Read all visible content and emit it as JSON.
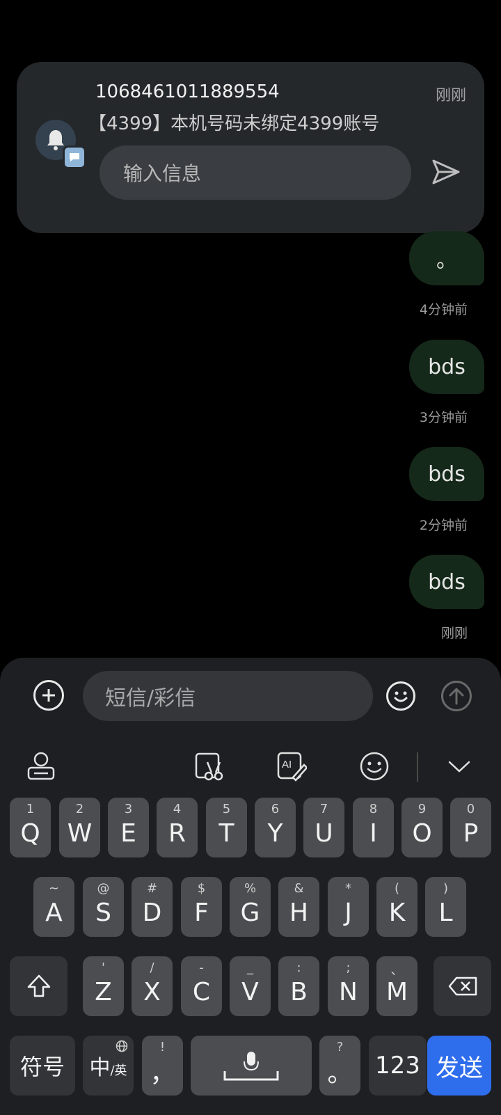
{
  "notification": {
    "sender": "1068461011889554",
    "time": "刚刚",
    "body": "【4399】本机号码未绑定4399账号",
    "reply_placeholder": "输入信息",
    "icon": "bell-icon",
    "badge_icon": "message-icon",
    "send_icon": "send-icon"
  },
  "messages": [
    {
      "text": "。",
      "time": "4分钟前"
    },
    {
      "text": "bds",
      "time": "3分钟前"
    },
    {
      "text": "bds",
      "time": "2分钟前"
    },
    {
      "text": "bds",
      "time": "刚刚"
    }
  ],
  "compose": {
    "placeholder": "短信/彩信",
    "add_icon": "plus-circle-icon",
    "emoji_icon": "emoji-icon",
    "send_icon": "arrow-up-icon"
  },
  "keyboard_toolbar": {
    "items": [
      "keyboard-settings-icon",
      "clipboard-edit-icon",
      "ai-write-icon",
      "emoji-icon",
      "chevron-down-icon"
    ]
  },
  "keyboard": {
    "row1": [
      {
        "main": "Q",
        "sub": "1"
      },
      {
        "main": "W",
        "sub": "2"
      },
      {
        "main": "E",
        "sub": "3"
      },
      {
        "main": "R",
        "sub": "4"
      },
      {
        "main": "T",
        "sub": "5"
      },
      {
        "main": "Y",
        "sub": "6"
      },
      {
        "main": "U",
        "sub": "7"
      },
      {
        "main": "I",
        "sub": "8"
      },
      {
        "main": "O",
        "sub": "9"
      },
      {
        "main": "P",
        "sub": "0"
      }
    ],
    "row2": [
      {
        "main": "A",
        "sub": "~"
      },
      {
        "main": "S",
        "sub": "@"
      },
      {
        "main": "D",
        "sub": "#"
      },
      {
        "main": "F",
        "sub": "$"
      },
      {
        "main": "G",
        "sub": "%"
      },
      {
        "main": "H",
        "sub": "&"
      },
      {
        "main": "J",
        "sub": "*"
      },
      {
        "main": "K",
        "sub": "("
      },
      {
        "main": "L",
        "sub": ")"
      }
    ],
    "row3": [
      {
        "main": "Z",
        "sub": "'"
      },
      {
        "main": "X",
        "sub": "/"
      },
      {
        "main": "C",
        "sub": "-"
      },
      {
        "main": "V",
        "sub": "_"
      },
      {
        "main": "B",
        "sub": ":"
      },
      {
        "main": "N",
        "sub": ";"
      },
      {
        "main": "M",
        "sub": "、"
      }
    ],
    "symbols": "符号",
    "lang_main": "中",
    "lang_sub": "/英",
    "comma_main": "，",
    "comma_sub": "!",
    "period_main": "。",
    "period_sub": "?",
    "num": "123",
    "send": "发送"
  },
  "colors": {
    "send_key": "#2e6dec",
    "bubble": "#15291a",
    "notification_bg": "#25282b"
  }
}
